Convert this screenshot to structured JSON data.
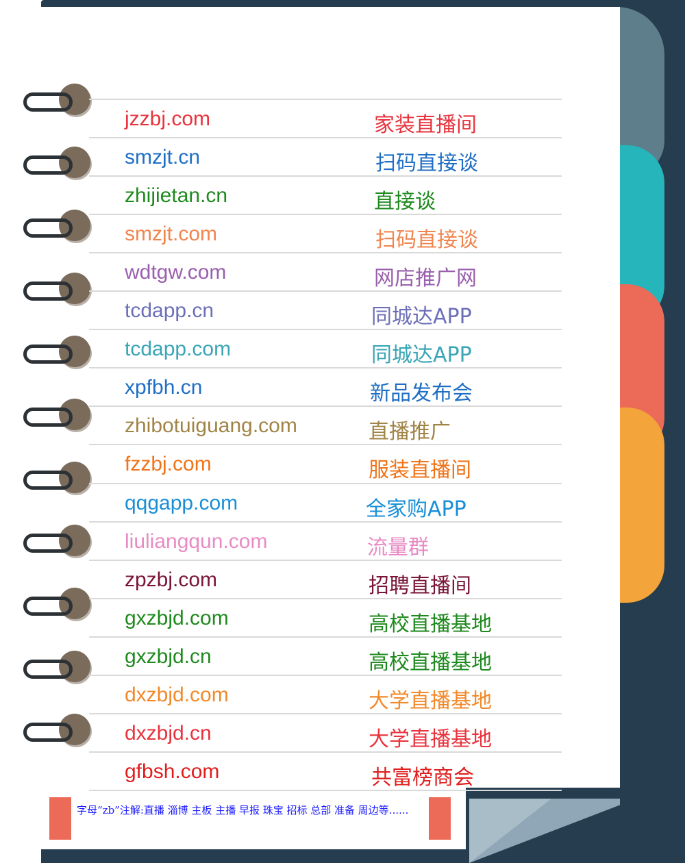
{
  "colors": {
    "cover": "#253d4e",
    "tab_grey": "#5f7e8c",
    "tab_teal": "#25b5bb",
    "tab_coral": "#ec6a58",
    "tab_orange": "#f3a43a",
    "ring": "#7a6b5b"
  },
  "rows": [
    {
      "domain": "jzzbj.com",
      "meaning": "家装直播间",
      "color": "#e8333d"
    },
    {
      "domain": "smzjt.cn",
      "meaning": "扫码直接谈",
      "color": "#1f6fc4"
    },
    {
      "domain": "zhijietan.cn",
      "meaning": "直接谈",
      "color": "#1e8a1e"
    },
    {
      "domain": "smzjt.com",
      "meaning": "扫码直接谈",
      "color": "#f0854e"
    },
    {
      "domain": "wdtgw.com",
      "meaning": "网店推广网",
      "color": "#9a5fae"
    },
    {
      "domain": "tcdapp.cn",
      "meaning": "同城达APP",
      "color": "#6c6fb8"
    },
    {
      "domain": "tcdapp.com",
      "meaning": "同城达APP",
      "color": "#3aa5b5"
    },
    {
      "domain": "xpfbh.cn",
      "meaning": "新品发布会",
      "color": "#1f6fc4"
    },
    {
      "domain": "zhibotuiguang.com",
      "meaning": "直播推广",
      "color": "#a08446"
    },
    {
      "domain": "fzzbj.com",
      "meaning": "服装直播间",
      "color": "#f07418"
    },
    {
      "domain": "qqgapp.com",
      "meaning": "全家购APP",
      "color": "#1a8fd6"
    },
    {
      "domain": "liuliangqun.com",
      "meaning": "流量群",
      "color": "#e88bc4"
    },
    {
      "domain": "zpzbj.com",
      "meaning": "招聘直播间",
      "color": "#7a1538"
    },
    {
      "domain": "gxzbjd.com",
      "meaning": "高校直播基地",
      "color": "#1e8a1e"
    },
    {
      "domain": "gxzbjd.cn",
      "meaning": "高校直播基地",
      "color": "#1e8a1e"
    },
    {
      "domain": "dxzbjd.com",
      "meaning": "大学直播基地",
      "color": "#f2892a"
    },
    {
      "domain": "dxzbjd.cn",
      "meaning": "大学直播基地",
      "color": "#e8333d"
    },
    {
      "domain": "gfbsh.com",
      "meaning": "共富榜商会",
      "color": "#e01e1e"
    }
  ],
  "footer": {
    "note": "字母“zb”注解:直播 淄博 主板 主播 早报 珠宝 招标 总部 准备 周边等......",
    "color": "#1a1aff"
  }
}
